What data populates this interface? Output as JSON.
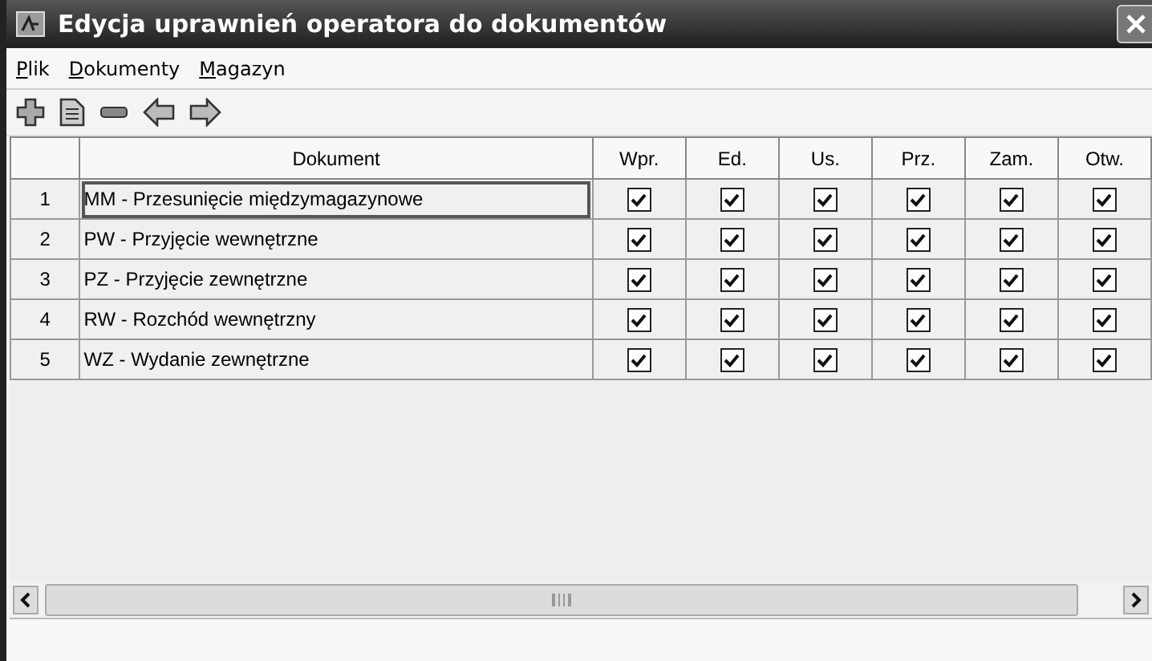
{
  "window": {
    "title": "Edycja uprawnień operatora do dokumentów"
  },
  "menu": [
    "Plik",
    "Dokumenty",
    "Magazyn"
  ],
  "toolbar": [
    {
      "kind": "add"
    },
    {
      "kind": "document"
    },
    {
      "kind": "remove"
    },
    {
      "kind": "back"
    },
    {
      "kind": "forward"
    }
  ],
  "table": {
    "columns": [
      "Dokument",
      "Wpr.",
      "Ed.",
      "Us.",
      "Prz.",
      "Zam.",
      "Otw."
    ],
    "rows": [
      {
        "number": "1",
        "document": "MM - Przesunięcie międzymagazynowe",
        "selected": true,
        "checks": [
          true,
          true,
          true,
          true,
          true,
          true
        ]
      },
      {
        "number": "2",
        "document": "PW - Przyjęcie wewnętrzne",
        "selected": false,
        "checks": [
          true,
          true,
          true,
          true,
          true,
          true
        ]
      },
      {
        "number": "3",
        "document": "PZ - Przyjęcie zewnętrzne",
        "selected": false,
        "checks": [
          true,
          true,
          true,
          true,
          true,
          true
        ]
      },
      {
        "number": "4",
        "document": "RW - Rozchód wewnętrzny",
        "selected": false,
        "checks": [
          true,
          true,
          true,
          true,
          true,
          true
        ]
      },
      {
        "number": "5",
        "document": "WZ - Wydanie zewnętrzne",
        "selected": false,
        "checks": [
          true,
          true,
          true,
          true,
          true,
          true
        ]
      }
    ]
  }
}
